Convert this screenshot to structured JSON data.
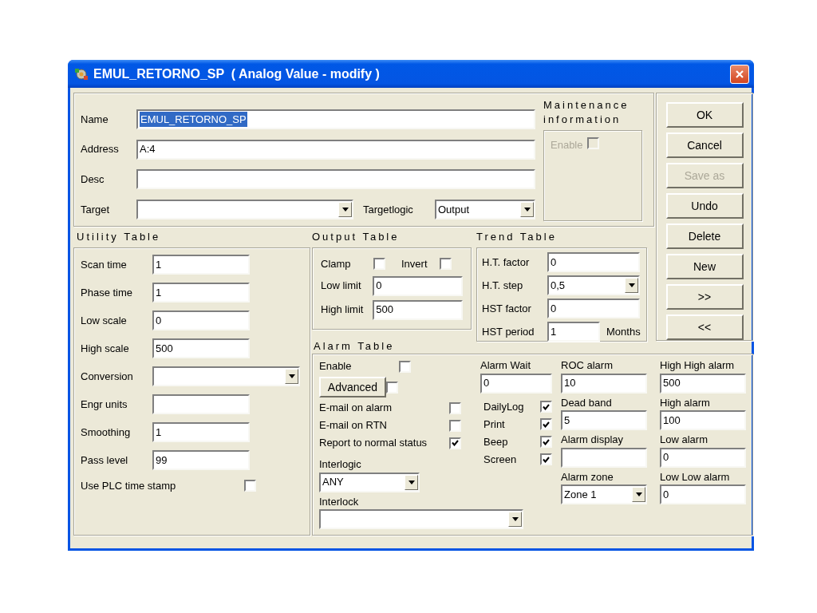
{
  "window": {
    "title": "EMUL_RETORNO_SP  ( Analog Value - modify )"
  },
  "general": {
    "fields": [
      {
        "label": "Name",
        "value": "EMUL_RETORNO_SP",
        "highlighted": true
      },
      {
        "label": "Address",
        "value": "A:4"
      },
      {
        "label": "Desc"
      }
    ],
    "target": {
      "label": "Target"
    },
    "targetlogic": {
      "label": "Targetlogic",
      "value": "Output"
    }
  },
  "maintenance": {
    "title": "Maintenance information",
    "enable": {
      "label": "Enable",
      "checked": false,
      "disabled": true
    }
  },
  "buttons": [
    {
      "label": "OK",
      "disabled": false
    },
    {
      "label": "Cancel",
      "disabled": false
    },
    {
      "label": "Save as",
      "disabled": true
    },
    {
      "label": "Undo",
      "disabled": false
    },
    {
      "label": "Delete",
      "disabled": false
    },
    {
      "label": "New",
      "disabled": false
    },
    {
      "label": ">>",
      "disabled": false
    },
    {
      "label": "<<",
      "disabled": false
    }
  ],
  "utility_table": {
    "title": "Utility Table",
    "rows": [
      {
        "kind": "text",
        "label": "Scan time",
        "value": "1"
      },
      {
        "kind": "text",
        "label": "Phase time",
        "value": "1"
      },
      {
        "kind": "text",
        "label": "Low scale",
        "value": "0"
      },
      {
        "kind": "text",
        "label": "High scale",
        "value": "500"
      },
      {
        "kind": "dropdown",
        "label": "Conversion"
      },
      {
        "kind": "text",
        "label": "Engr units"
      },
      {
        "kind": "text",
        "label": "Smoothing",
        "value": "1"
      },
      {
        "kind": "text",
        "label": "Pass level",
        "value": "99"
      },
      {
        "kind": "checkbox",
        "label": "Use PLC time stamp",
        "checked": false
      }
    ]
  },
  "output_table": {
    "title": "Output Table",
    "clamp": {
      "label": "Clamp",
      "checked": false
    },
    "invert": {
      "label": "Invert",
      "checked": false
    },
    "fields": [
      {
        "label": "Low limit",
        "value": "0"
      },
      {
        "label": "High limit",
        "value": "500"
      }
    ]
  },
  "trend_table": {
    "title": "Trend Table",
    "rows": [
      {
        "kind": "text",
        "label": "H.T. factor",
        "value": "0"
      },
      {
        "kind": "dropdown",
        "label": "H.T. step",
        "value": "0,5"
      },
      {
        "kind": "text",
        "label": "HST factor",
        "value": "0"
      },
      {
        "kind": "text_with_unit",
        "label": "HST period",
        "value": "1",
        "unit": "Months"
      }
    ]
  },
  "alarm_table": {
    "title": "Alarm Table",
    "enable": {
      "label": "Enable",
      "checked": false
    },
    "advanced": {
      "label": "Advanced",
      "checked": false
    },
    "notify": [
      {
        "label": "E-mail on alarm",
        "checked": false
      },
      {
        "label": "E-mail on RTN",
        "checked": false
      },
      {
        "label": "Report to normal status",
        "checked": true
      }
    ],
    "interlogic": {
      "label": "Interlogic",
      "value": "ANY"
    },
    "interlock": {
      "label": "Interlock"
    },
    "alarm_wait": {
      "label": "Alarm Wait",
      "value": "0"
    },
    "outputs": [
      {
        "label": "DailyLog",
        "checked": true
      },
      {
        "label": "Print",
        "checked": true
      },
      {
        "label": "Beep",
        "checked": true
      },
      {
        "label": "Screen",
        "checked": true
      }
    ],
    "column_3": [
      {
        "kind": "text",
        "label": "ROC alarm",
        "value": "10"
      },
      {
        "kind": "text",
        "label": "Dead band",
        "value": "5"
      },
      {
        "kind": "text",
        "label": "Alarm display"
      },
      {
        "kind": "dropdown",
        "label": "Alarm zone",
        "value": "Zone 1"
      }
    ],
    "column_4": [
      {
        "kind": "text",
        "label": "High High alarm",
        "value": "500"
      },
      {
        "kind": "text",
        "label": "High alarm",
        "value": "100"
      },
      {
        "kind": "text",
        "label": "Low alarm",
        "value": "0"
      },
      {
        "kind": "text",
        "label": "Low Low alarm",
        "value": "0"
      }
    ]
  }
}
